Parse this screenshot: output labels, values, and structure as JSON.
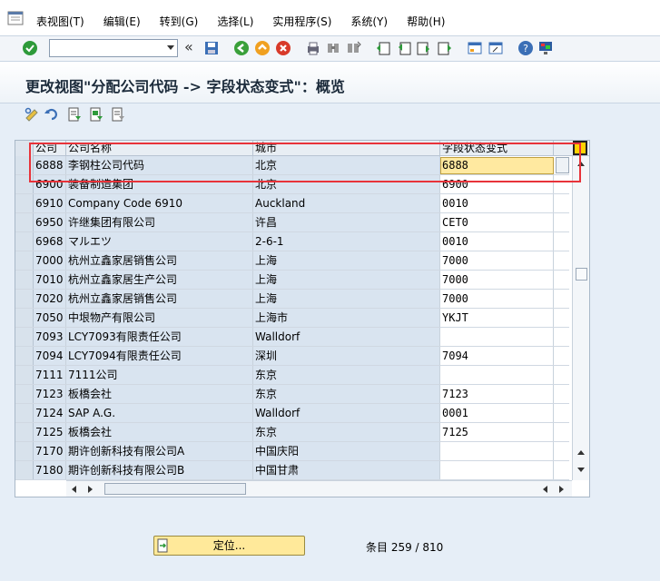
{
  "menubar": {
    "items": [
      "表视图(T)",
      "编辑(E)",
      "转到(G)",
      "选择(L)",
      "实用程序(S)",
      "系统(Y)",
      "帮助(H)"
    ]
  },
  "toolbar": {
    "command_field_value": "",
    "icons": [
      "check-icon",
      "back-double-icon",
      "save-icon",
      "back-icon",
      "exit-icon",
      "cancel-icon",
      "print-icon",
      "find-icon",
      "find-next-icon",
      "first-page-icon",
      "prev-page-icon",
      "next-page-icon",
      "last-page-icon",
      "new-session-icon",
      "shortcut-icon",
      "help-icon",
      "customize-layout-icon"
    ]
  },
  "page": {
    "title": "更改视图\"分配公司代码 -> 字段状态变式\"：概览"
  },
  "app_toolbar": {
    "icons": [
      "display-change-icon",
      "undo-icon",
      "select-all-icon",
      "select-block-icon",
      "deselect-all-icon"
    ]
  },
  "table": {
    "columns": [
      "公司",
      "公司名称",
      "城市",
      "字段状态变式"
    ],
    "editing_value": "6888",
    "rows": [
      {
        "code": "6888",
        "name": "李钢柱公司代码",
        "city": "北京",
        "variant": "6888"
      },
      {
        "code": "6900",
        "name": "装备制造集团",
        "city": "北京",
        "variant": "6900"
      },
      {
        "code": "6910",
        "name": "Company Code 6910",
        "city": "Auckland",
        "variant": "0010"
      },
      {
        "code": "6950",
        "name": "许继集团有限公司",
        "city": "许昌",
        "variant": "CET0"
      },
      {
        "code": "6968",
        "name": "マルエツ",
        "city": "2-6-1",
        "variant": "0010"
      },
      {
        "code": "7000",
        "name": "杭州立鑫家居销售公司",
        "city": "上海",
        "variant": "7000"
      },
      {
        "code": "7010",
        "name": "杭州立鑫家居生产公司",
        "city": "上海",
        "variant": "7000"
      },
      {
        "code": "7020",
        "name": "杭州立鑫家居销售公司",
        "city": "上海",
        "variant": "7000"
      },
      {
        "code": "7050",
        "name": "中垠物产有限公司",
        "city": "上海市",
        "variant": "YKJT"
      },
      {
        "code": "7093",
        "name": "LCY7093有限责任公司",
        "city": "Walldorf",
        "variant": ""
      },
      {
        "code": "7094",
        "name": "LCY7094有限责任公司",
        "city": "深圳",
        "variant": "7094"
      },
      {
        "code": "7111",
        "name": "7111公司",
        "city": "东京",
        "variant": ""
      },
      {
        "code": "7123",
        "name": "板橋会社",
        "city": "东京",
        "variant": "7123"
      },
      {
        "code": "7124",
        "name": "SAP A.G.",
        "city": "Walldorf",
        "variant": "0001"
      },
      {
        "code": "7125",
        "name": "板橋会社",
        "city": "东京",
        "variant": "7125"
      },
      {
        "code": "7170",
        "name": "期许创新科技有限公司A",
        "city": "中国庆阳",
        "variant": ""
      },
      {
        "code": "7180",
        "name": "期许创新科技有限公司B",
        "city": "中国甘肃",
        "variant": ""
      }
    ]
  },
  "footer": {
    "position_button_label": "定位...",
    "entries_text": "条目 259 / 810"
  },
  "colors": {
    "highlight_box": "#e8333a",
    "edit_cell": "#ffe9a0",
    "key_column": "#d9e4f0"
  }
}
